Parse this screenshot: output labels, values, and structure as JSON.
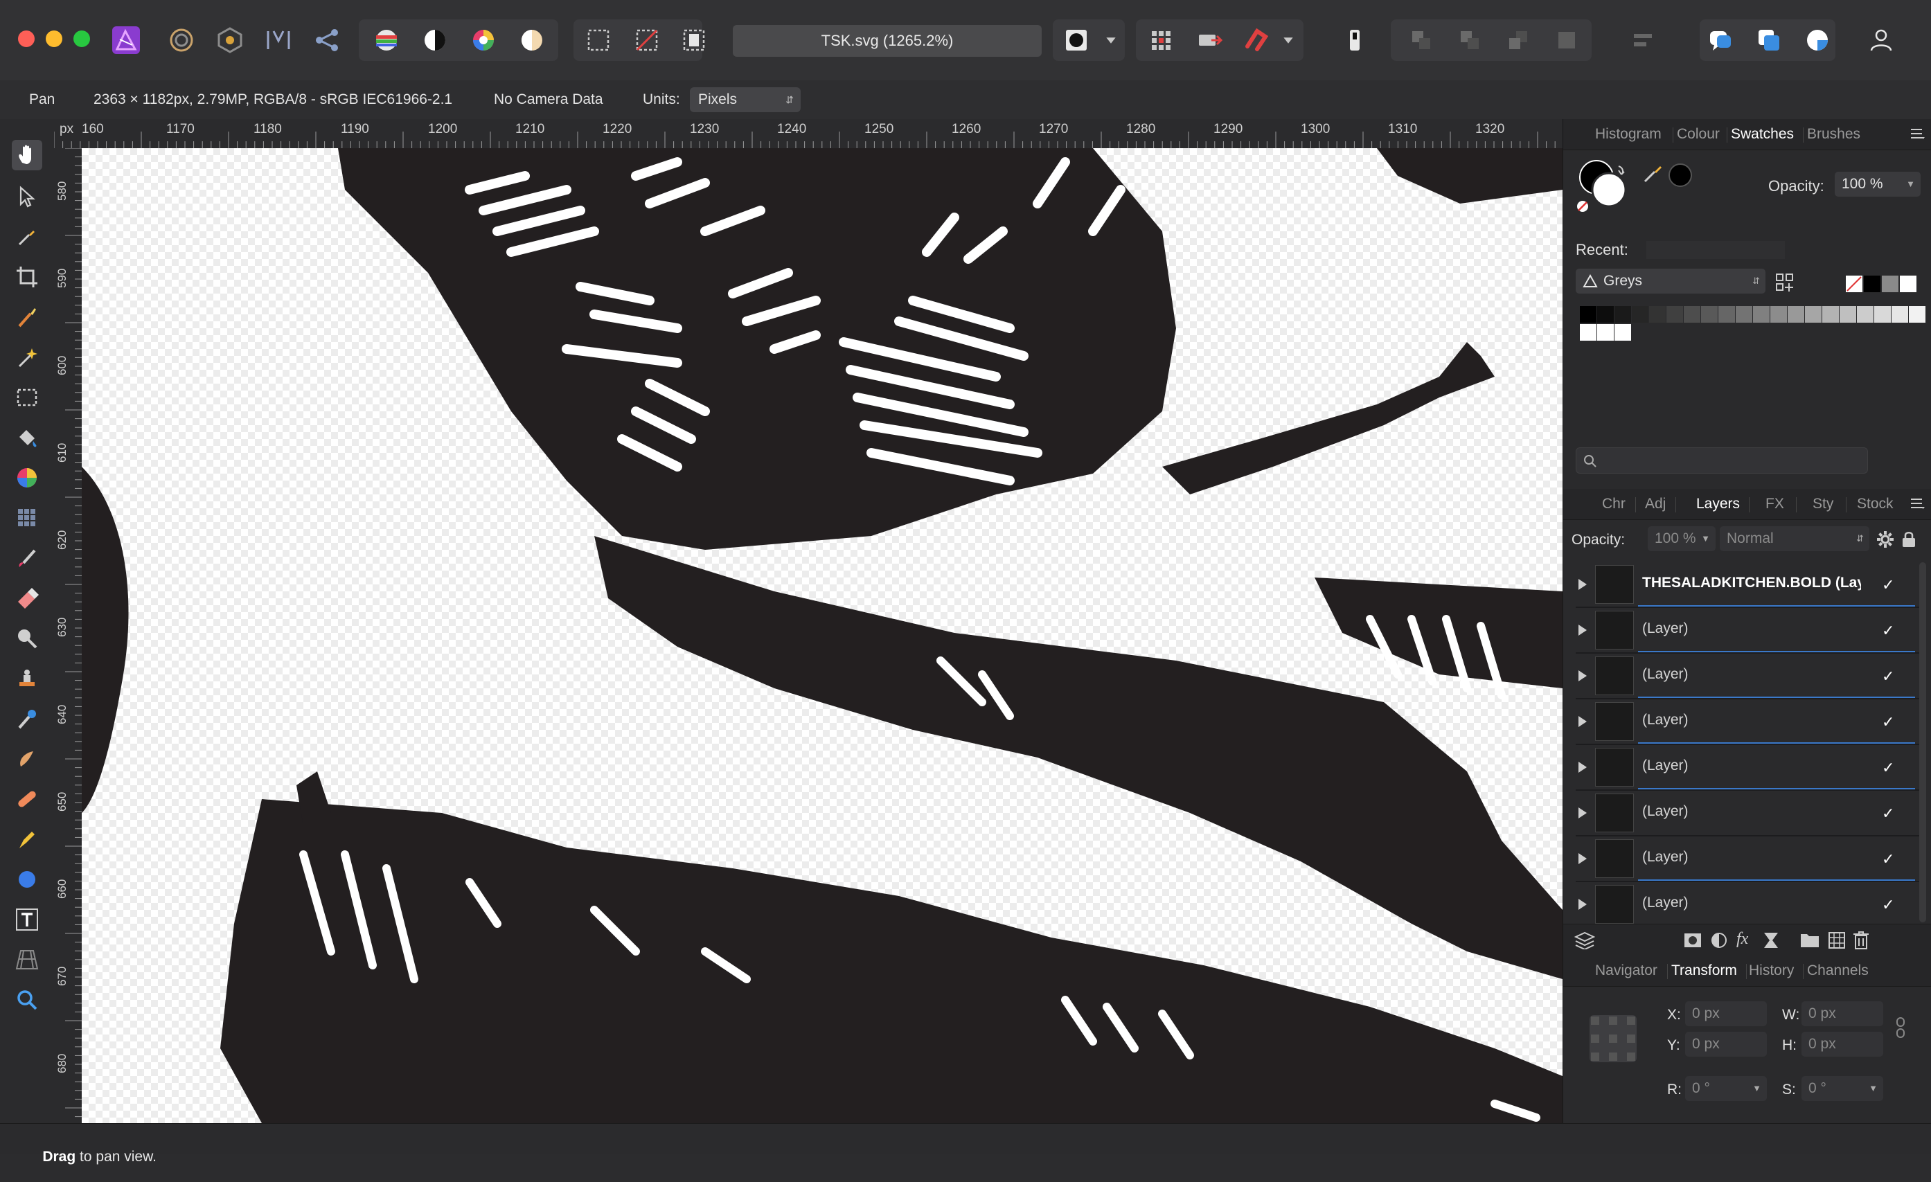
{
  "toolbar": {
    "document_title": "TSK.svg (1265.2%)"
  },
  "context_bar": {
    "tool_name": "Pan",
    "image_info": "2363 × 1182px, 2.79MP, RGBA/8 - sRGB IEC61966-2.1",
    "camera": "No Camera Data",
    "units_label": "Units:",
    "units_value": "Pixels"
  },
  "rulers": {
    "unit": "px",
    "top_ticks": [
      "160",
      "1170",
      "1180",
      "1190",
      "1200",
      "1210",
      "1220",
      "1230",
      "1240",
      "1250",
      "1260",
      "1270",
      "1280",
      "1290",
      "1300",
      "1310",
      "1320"
    ],
    "left_ticks": [
      "580",
      "590",
      "600",
      "610",
      "620",
      "630",
      "640",
      "650",
      "660",
      "670",
      "680"
    ]
  },
  "swatches_panel": {
    "tabs": [
      "Histogram",
      "Colour",
      "Swatches",
      "Brushes"
    ],
    "active_tab": "Swatches",
    "opacity_label": "Opacity:",
    "opacity_value": "100 %",
    "recent_label": "Recent:",
    "palette_name": "Greys",
    "search_placeholder": ""
  },
  "layers_panel": {
    "tabs": [
      "Chr",
      "Adj",
      "Layers",
      "FX",
      "Sty",
      "Stock"
    ],
    "active_tab": "Layers",
    "opacity_label": "Opacity:",
    "opacity_value": "100 %",
    "blend_mode": "Normal",
    "layers": [
      {
        "name": "THESALADKITCHEN.BOLD (Layer)",
        "bold": true,
        "visible": "✓"
      },
      {
        "name": "(Layer)",
        "visible": "✓"
      },
      {
        "name": "(Layer)",
        "visible": "✓"
      },
      {
        "name": "(Layer)",
        "visible": "✓"
      },
      {
        "name": "(Layer)",
        "visible": "✓"
      },
      {
        "name": "(Layer)",
        "visible": "✓"
      },
      {
        "name": "(Layer)",
        "visible": "✓"
      },
      {
        "name": "(Layer)",
        "visible": "✓"
      }
    ]
  },
  "transform_panel": {
    "tabs": [
      "Navigator",
      "Transform",
      "History",
      "Channels"
    ],
    "active_tab": "Transform",
    "x_label": "X:",
    "x_value": "0 px",
    "y_label": "Y:",
    "y_value": "0 px",
    "w_label": "W:",
    "w_value": "0 px",
    "h_label": "H:",
    "h_value": "0 px",
    "r_label": "R:",
    "r_value": "0 °",
    "s_label": "S:",
    "s_value": "0 °"
  },
  "status": {
    "bold": "Drag",
    "text": " to pan view."
  },
  "colors": {
    "accent": "#3a78c9",
    "artwork": "#231f20"
  }
}
